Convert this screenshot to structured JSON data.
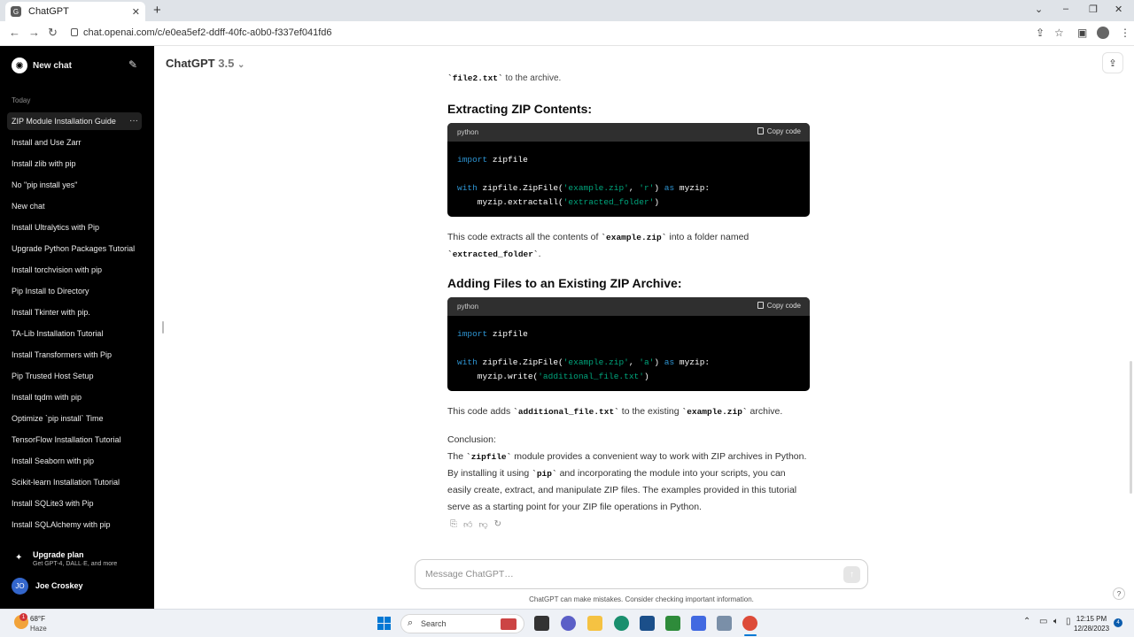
{
  "browser": {
    "tab_title": "ChatGPT",
    "tab_favicon": "G",
    "tab_close": "✕",
    "new_tab": "+",
    "url": "chat.openai.com/c/e0ea5ef2-ddff-40fc-a0b0-f337ef041fd6",
    "window_controls": [
      "⌄",
      "–",
      "❐",
      "✕"
    ]
  },
  "sidebar": {
    "new_chat": "New chat",
    "section": "Today",
    "items": [
      "ZIP Module Installation Guide",
      "Install and Use Zarr",
      "Install zlib with pip",
      "No \"pip install yes\"",
      "New chat",
      "Install Ultralytics with Pip",
      "Upgrade Python Packages Tutorial",
      "Install torchvision with pip",
      "Pip Install to Directory",
      "Install Tkinter with pip.",
      "TA-Lib Installation Tutorial",
      "Install Transformers with Pip",
      "Pip Trusted Host Setup",
      "Install tqdm with pip",
      "Optimize `pip install` Time",
      "TensorFlow Installation Tutorial",
      "Install Seaborn with pip",
      "Scikit-learn Installation Tutorial",
      "Install SQLite3 with Pip",
      "Install SQLAlchemy with pip"
    ],
    "active_index": 0,
    "more": "···",
    "upgrade_title": "Upgrade plan",
    "upgrade_sub": "Get GPT-4, DALL·E, and more",
    "user_initials": "JO",
    "user_name": "Joe Croskey"
  },
  "header": {
    "model": "ChatGPT",
    "version": "3.5",
    "chevron": "⌄",
    "share_icon": "⇪"
  },
  "message": {
    "prev_code": "`file2.txt`",
    "prev_text": " to the archive.",
    "h_extract": "Extracting ZIP Contents:",
    "code_lang": "python",
    "copy_label": "Copy code",
    "extract_code": {
      "l1_kw": "import",
      "l1_rest": " zipfile",
      "l2_kw": "with",
      "l2_a": " zipfile.ZipFile(",
      "l2_s1": "'example.zip'",
      "l2_b": ", ",
      "l2_s2": "'r'",
      "l2_c": ") ",
      "l2_kw2": "as",
      "l2_d": " myzip:",
      "l3_a": "    myzip.extractall(",
      "l3_s": "'extracted_folder'",
      "l3_b": ")"
    },
    "p1_a": "This code extracts all the contents of ",
    "p1_code1": "`example.zip`",
    "p1_b": " into a folder named",
    "p1_code2": "`extracted_folder`",
    "p1_c": ".",
    "h_add": "Adding Files to an Existing ZIP Archive:",
    "add_code": {
      "l1_kw": "import",
      "l1_rest": " zipfile",
      "l2_kw": "with",
      "l2_a": " zipfile.ZipFile(",
      "l2_s1": "'example.zip'",
      "l2_b": ", ",
      "l2_s2": "'a'",
      "l2_c": ") ",
      "l2_kw2": "as",
      "l2_d": " myzip:",
      "l3_a": "    myzip.write(",
      "l3_s": "'additional_file.txt'",
      "l3_b": ")"
    },
    "p2_a": "This code adds ",
    "p2_code1": "`additional_file.txt`",
    "p2_b": " to the existing ",
    "p2_code2": "`example.zip`",
    "p2_c": " archive.",
    "conclusion_label": "Conclusion:",
    "c_a": "The ",
    "c_code1": "`zipfile`",
    "c_b": " module provides a convenient way to work with ZIP archives in Python. By installing it using ",
    "c_code2": "`pip`",
    "c_c": " and incorporating the module into your scripts, you can easily create, extract, and manipulate ZIP files. The examples provided in this tutorial serve as a starting point for your ZIP file operations in Python."
  },
  "composer": {
    "placeholder": "Message ChatGPT…",
    "send_icon": "↑",
    "disclaimer": "ChatGPT can make mistakes. Consider checking important information.",
    "help": "?"
  },
  "taskbar": {
    "temp": "68°F",
    "condition": "Haze",
    "weather_badge": "1",
    "search": "Search",
    "time": "12:15 PM",
    "date": "12/28/2023",
    "notif_count": "4"
  }
}
